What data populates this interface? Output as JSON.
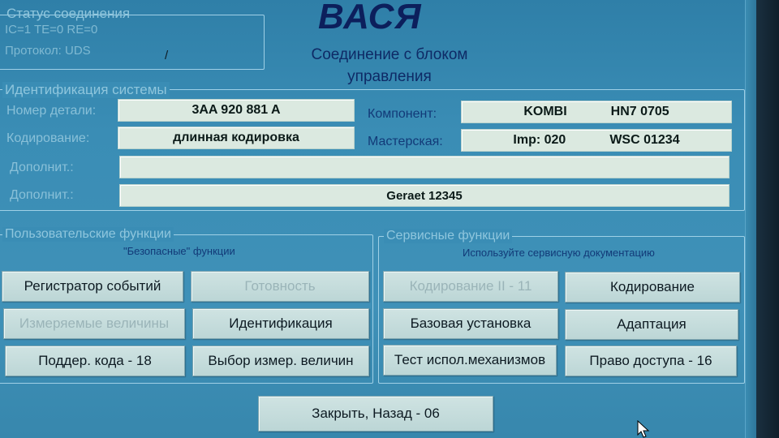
{
  "status": {
    "title": "Статус соединения",
    "line1": "IC=1  TE=0  RE=0",
    "line2": "Протокол: UDS",
    "marker": "/"
  },
  "header": {
    "app_title": "ВАСЯ",
    "subtitle": "Соединение с блоком управления"
  },
  "identification": {
    "title": "Идентификация системы",
    "part_number_label": "Номер детали:",
    "part_number_value": "3AA 920 881 A",
    "coding_label": "Кодирование:",
    "coding_value": "длинная кодировка",
    "component_label": "Компонент:",
    "component_value_a": "KOMBI",
    "component_value_b": "HN7 0705",
    "workshop_label": "Мастерская:",
    "workshop_value_a": "Imp: 020",
    "workshop_value_b": "WSC 01234",
    "extra1_label": "Дополнит.:",
    "extra1_value": "",
    "extra2_label": "Дополнит.:",
    "extra2_value": "Geraet 12345"
  },
  "user_functions": {
    "title": "Пользовательские функции",
    "hint": "\"Безопасные\" функции",
    "buttons": [
      {
        "label": "Регистратор событий",
        "enabled": true
      },
      {
        "label": "Готовность",
        "enabled": false
      },
      {
        "label": "Измеряемые величины",
        "enabled": false
      },
      {
        "label": "Идентификация",
        "enabled": true
      },
      {
        "label": "Поддер. кода - 18",
        "enabled": true
      },
      {
        "label": "Выбор измер. величин",
        "enabled": true
      }
    ]
  },
  "service_functions": {
    "title": "Сервисные функции",
    "hint": "Используйте сервисную документацию",
    "buttons": [
      {
        "label": "Кодирование II - 11",
        "enabled": false
      },
      {
        "label": "Кодирование",
        "enabled": true
      },
      {
        "label": "Базовая установка",
        "enabled": true
      },
      {
        "label": "Адаптация",
        "enabled": true
      },
      {
        "label": "Тест испол.механизмов",
        "enabled": true
      },
      {
        "label": "Право доступа - 16",
        "enabled": true
      }
    ]
  },
  "footer": {
    "close_label": "Закрыть, Назад - 06"
  },
  "colors": {
    "background": "#3a8db5",
    "title": "#0c1f5c",
    "field": "#dbe9e0",
    "button": "#c6dcdc"
  }
}
